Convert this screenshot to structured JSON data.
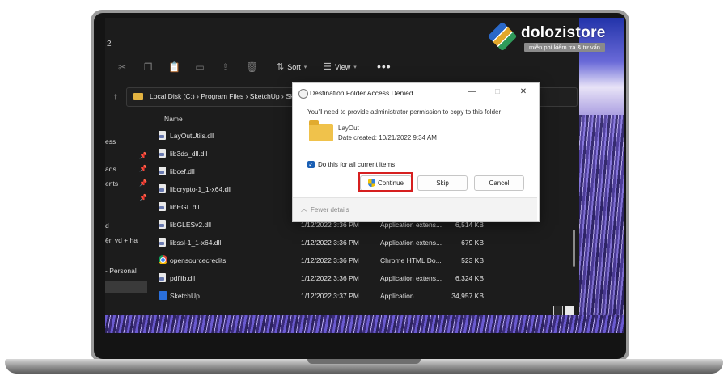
{
  "brand": {
    "name": "dolozistore",
    "tagline": "miễn phí kiểm tra & tư vấn"
  },
  "explorer": {
    "title_fragment": "2",
    "toolbar": {
      "sort_label": "Sort",
      "view_label": "View",
      "more_label": "•••"
    },
    "breadcrumb": [
      "Local Disk (C:)",
      "Program Files",
      "SketchUp",
      "SketchUp"
    ],
    "sidebar": [
      "ess",
      "ads",
      "ents",
      "d",
      "ện vd + ha",
      "- Personal"
    ],
    "column_name": "Name",
    "files": [
      {
        "name": "LayOutUtils.dll",
        "date": "",
        "type": "",
        "size": "",
        "icon": "dll-icon"
      },
      {
        "name": "lib3ds_dll.dll",
        "date": "",
        "type": "",
        "size": "",
        "icon": "dll-icon"
      },
      {
        "name": "libcef.dll",
        "date": "",
        "type": "",
        "size": "",
        "icon": "dll-icon"
      },
      {
        "name": "libcrypto-1_1-x64.dll",
        "date": "",
        "type": "",
        "size": "",
        "icon": "dll-icon"
      },
      {
        "name": "libEGL.dll",
        "date": "",
        "type": "",
        "size": "",
        "icon": "dll-icon"
      },
      {
        "name": "libGLESv2.dll",
        "date": "1/12/2022 3:36 PM",
        "type": "Application extens...",
        "size": "6,514 KB",
        "icon": "dll-icon"
      },
      {
        "name": "libssl-1_1-x64.dll",
        "date": "1/12/2022 3:36 PM",
        "type": "Application extens...",
        "size": "679 KB",
        "icon": "dll-icon"
      },
      {
        "name": "opensourcecredits",
        "date": "1/12/2022 3:36 PM",
        "type": "Chrome HTML Do...",
        "size": "523 KB",
        "icon": "chrome-icon"
      },
      {
        "name": "pdflib.dll",
        "date": "1/12/2022 3:36 PM",
        "type": "Application extens...",
        "size": "6,324 KB",
        "icon": "dll-icon"
      },
      {
        "name": "SketchUp",
        "date": "1/12/2022 3:37 PM",
        "type": "Application",
        "size": "34,957 KB",
        "icon": "sketchup-icon"
      }
    ]
  },
  "dialog": {
    "title": "Destination Folder Access Denied",
    "message": "You'll need to provide administrator permission to copy to this folder",
    "folder_name": "LayOut",
    "folder_date": "Date created: 10/21/2022 9:34 AM",
    "checkbox_label": "Do this for all current items",
    "checkbox_checked": true,
    "continue_label": "Continue",
    "skip_label": "Skip",
    "cancel_label": "Cancel",
    "fewer_details_label": "Fewer details",
    "highlight_color": "#d61f1f"
  }
}
